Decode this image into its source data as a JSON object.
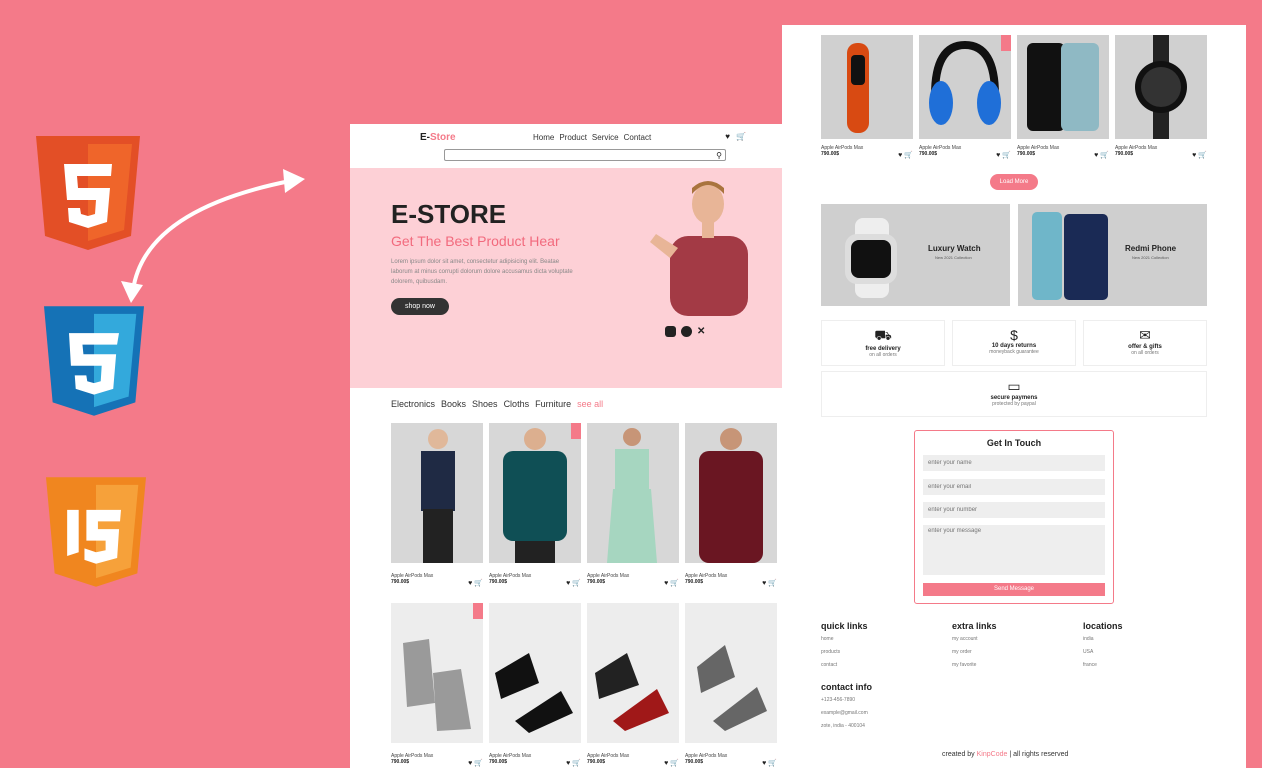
{
  "left": {
    "nav": {
      "logo_e": "E-",
      "logo_s": "Store",
      "menu": [
        "Home",
        "Product",
        "Service",
        "Contact"
      ]
    },
    "hero": {
      "title": "E-STORE",
      "subtitle": "Get The Best Product Hear",
      "text": "Lorem ipsum dolor sit amet, consectetur adipisicing elit. Beatae laborum at minus corrupti dolorum dolore accusamus dicta voluptate dolorem, quibusdam.",
      "button": "shop now"
    },
    "categories": [
      "Electronics",
      "Books",
      "Shoes",
      "Cloths",
      "Furniture"
    ],
    "see_all": "see all",
    "products": [
      {
        "name": "Apple AirPods Max",
        "price": "790.00$"
      },
      {
        "name": "Apple AirPods Max",
        "price": "790.00$"
      },
      {
        "name": "Apple AirPods Max",
        "price": "790.00$"
      },
      {
        "name": "Apple AirPods Max",
        "price": "790.00$"
      },
      {
        "name": "Apple AirPods Max",
        "price": "790.00$"
      },
      {
        "name": "Apple AirPods Max",
        "price": "790.00$"
      },
      {
        "name": "Apple AirPods Max",
        "price": "790.00$"
      },
      {
        "name": "Apple AirPods Max",
        "price": "790.00$"
      }
    ]
  },
  "right": {
    "products": [
      {
        "name": "Apple AirPods Max",
        "price": "790.00$"
      },
      {
        "name": "Apple AirPods Max",
        "price": "790.00$"
      },
      {
        "name": "Apple AirPods Max",
        "price": "790.00$"
      },
      {
        "name": "Apple AirPods Max",
        "price": "790.00$"
      }
    ],
    "load_more": "Load More",
    "promos": [
      {
        "title": "Luxury Watch",
        "sub": "New 2021 Collection"
      },
      {
        "title": "Redmi Phone",
        "sub": "New 2021 Collection"
      }
    ],
    "features": [
      {
        "title": "free delivery",
        "sub": "on all orders"
      },
      {
        "title": "10 days returns",
        "sub": "moneyback guarantee"
      },
      {
        "title": "offer & gifts",
        "sub": "on all orders"
      },
      {
        "title": "secure paymens",
        "sub": "protected by paypal"
      }
    ],
    "contact": {
      "title": "Get In Touch",
      "name_ph": "enter your name",
      "email_ph": "enter your email",
      "number_ph": "enter your number",
      "message_ph": "enter your message",
      "send": "Send Message"
    },
    "footer": {
      "quick_title": "quick links",
      "quick": [
        "home",
        "products",
        "contact"
      ],
      "extra_title": "extra links",
      "extra": [
        "my account",
        "my order",
        "my favorite"
      ],
      "loc_title": "locations",
      "loc": [
        "india",
        "USA",
        "france"
      ],
      "contact_title": "contact info",
      "contact": [
        "+123-456-7890",
        "example@gmail.com",
        "zote, india - 400104"
      ],
      "credit_pre": "created by",
      "credit_name": "KinpCode",
      "credit_post": "| all rights reserved"
    }
  }
}
